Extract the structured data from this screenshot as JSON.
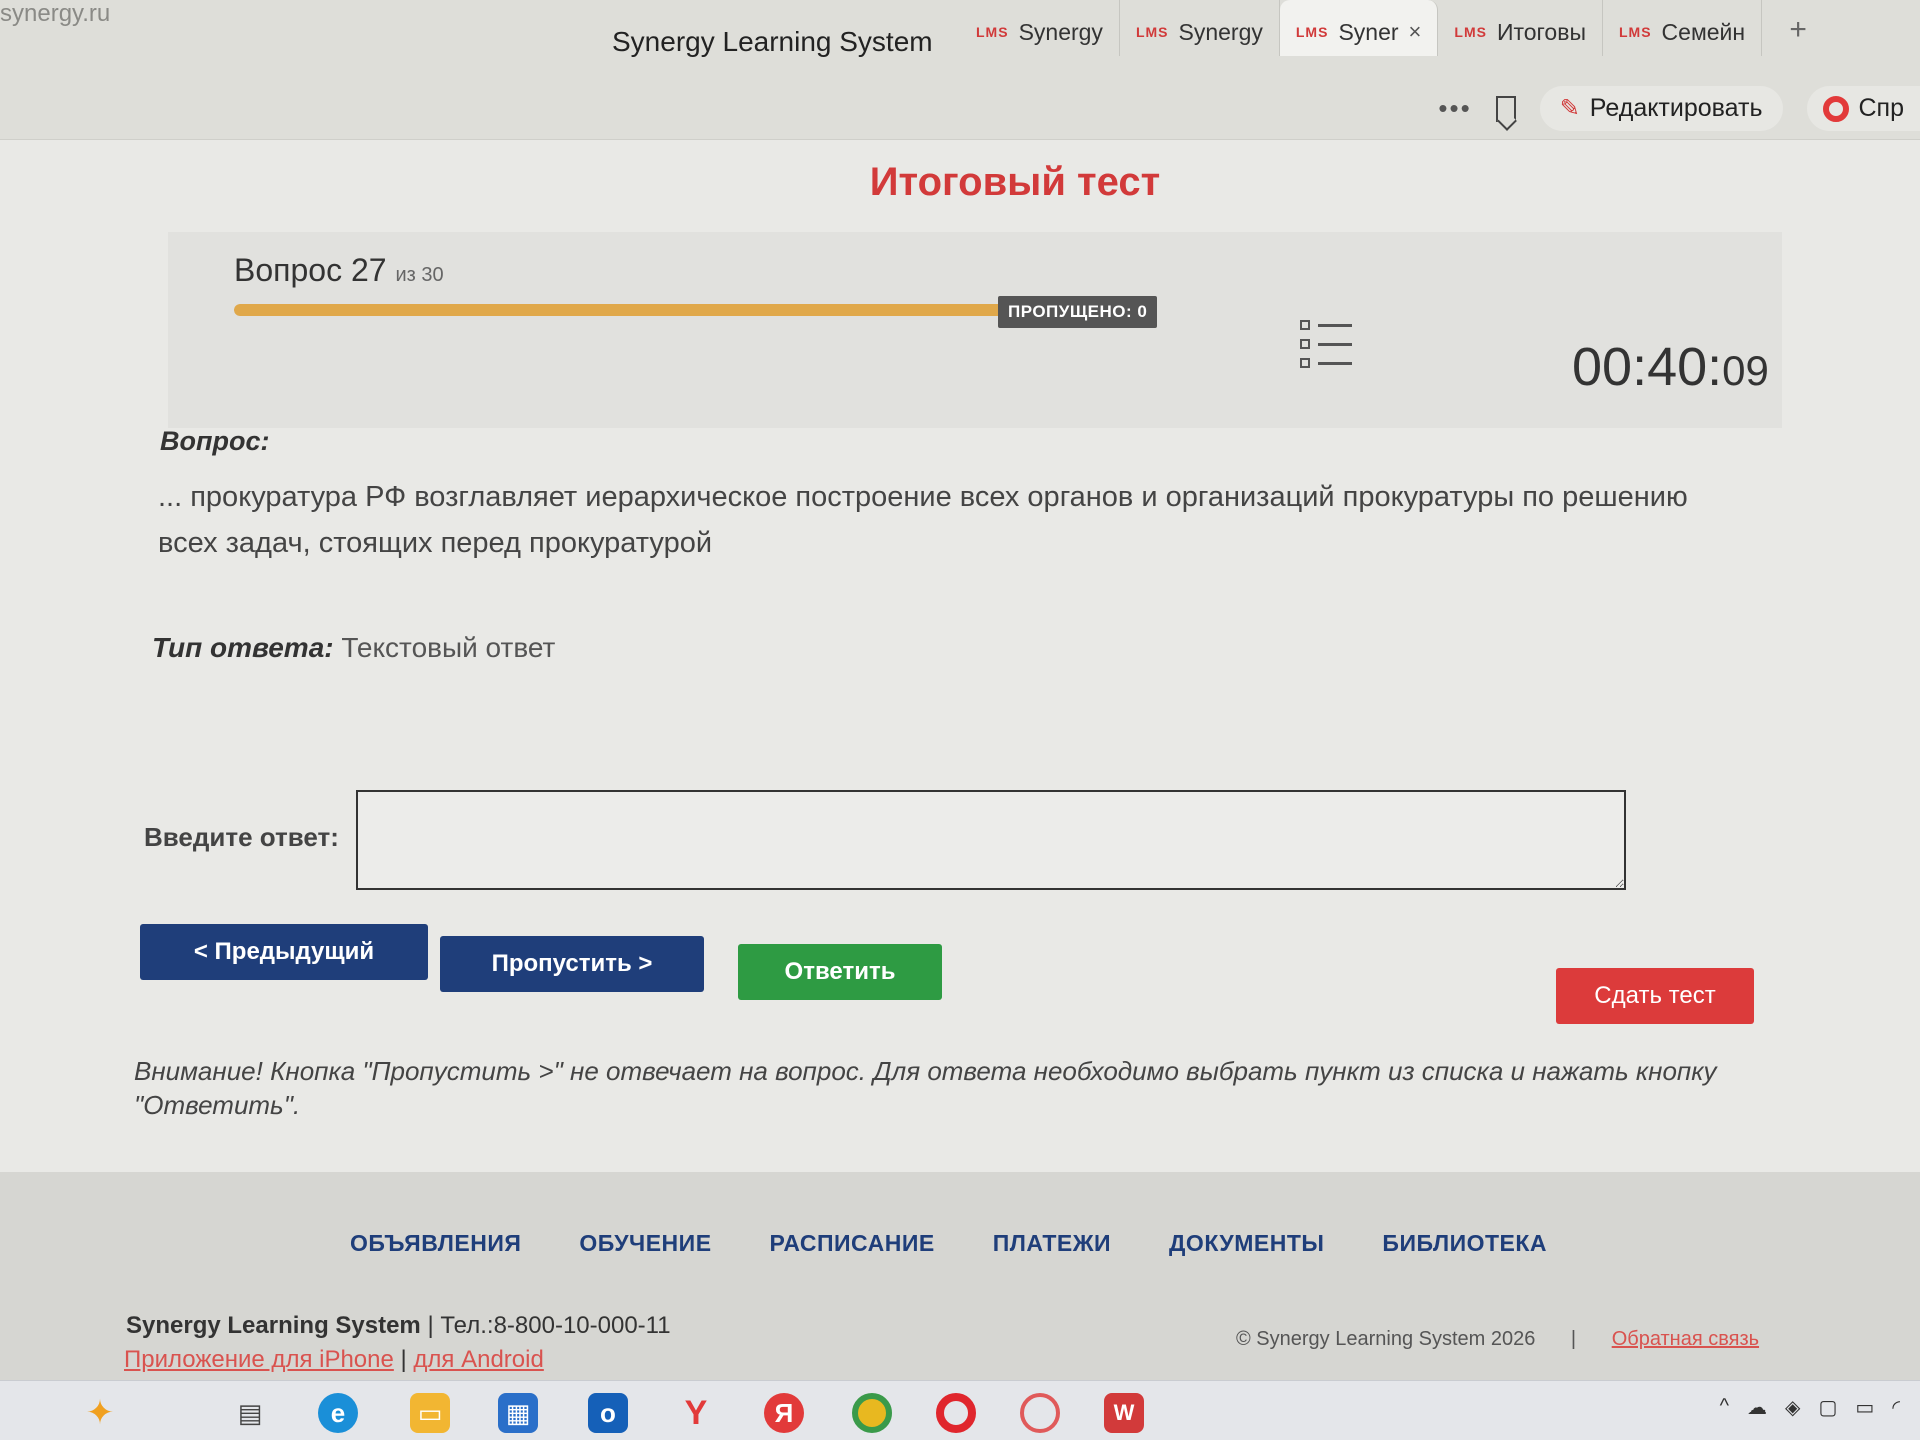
{
  "browser": {
    "address_fragment": "synergy.ru",
    "window_title": "Synergy Learning System",
    "tabs": [
      {
        "badge": "LMS",
        "label": "Synergy",
        "active": false
      },
      {
        "badge": "LMS",
        "label": "Synergy",
        "active": false
      },
      {
        "badge": "LMS",
        "label": "Syner",
        "active": true
      },
      {
        "badge": "LMS",
        "label": "Итоговы",
        "active": false
      },
      {
        "badge": "LMS",
        "label": "Семейн",
        "active": false
      }
    ],
    "new_tab": "+",
    "close_glyph": "×",
    "edit_label": "Редактировать",
    "ask_label": "Спр"
  },
  "test": {
    "title": "Итоговый тест",
    "question_prefix": "Вопрос 27",
    "question_of": "из 30",
    "progress": 0.9,
    "skipped_badge": "ПРОПУЩЕНО: 0",
    "timer_main": "00:40:",
    "timer_sec": "09"
  },
  "question": {
    "label": "Вопрос:",
    "text": "... прокуратура РФ возглавляет иерархическое построение всех органов и организаций прокуратуры по решению всех задач, стоящих перед прокуратурой",
    "type_label": "Тип ответа:",
    "type_value": "Текстовый ответ"
  },
  "answer": {
    "label": "Введите ответ:",
    "value": ""
  },
  "buttons": {
    "prev": "< Предыдущий",
    "skip": "Пропустить >",
    "answer": "Ответить",
    "submit": "Сдать тест"
  },
  "warning": "Внимание! Кнопка \"Пропустить >\" не отвечает на вопрос. Для ответа необходимо выбрать пункт из списка и нажать кнопку \"Ответить\".",
  "footer": {
    "nav": [
      "ОБЪЯВЛЕНИЯ",
      "ОБУЧЕНИЕ",
      "РАСПИСАНИЕ",
      "ПЛАТЕЖИ",
      "ДОКУМЕНТЫ",
      "БИБЛИОТЕКА"
    ],
    "brand": "Synergy Learning System",
    "separator": "|",
    "phone": "Тел.:8-800-10-000-11",
    "app_iphone": "Приложение для iPhone",
    "app_android": "для Android",
    "copyright": "© Synergy Learning System 2026",
    "feedback": "Обратная связь"
  },
  "colors": {
    "accent_red": "#d23a3a",
    "nav_blue": "#1f3e7a",
    "answer_green": "#2e9b43",
    "progress_orange": "#e0a84a"
  },
  "taskbar": {
    "icons": [
      "copilot-icon",
      "widgets-icon",
      "edge-icon",
      "explorer-icon",
      "store-icon",
      "outlook-icon",
      "yandex-browser-icon",
      "yandex-icon",
      "chrome-icon",
      "opera-icon",
      "opera-gx-icon",
      "wps-icon"
    ]
  }
}
